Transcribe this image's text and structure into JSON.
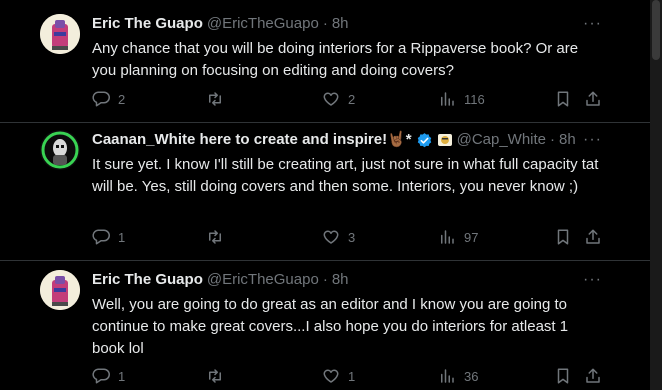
{
  "tweets": [
    {
      "display_name": "Eric The Guapo",
      "handle": "@EricTheGuapo",
      "separator": "·",
      "time": "8h",
      "more": "···",
      "text": "Any chance that you will be doing interiors for a Rippaverse book? Or are you planning on focusing on editing and doing covers?",
      "replies": "2",
      "retweets": "",
      "likes": "2",
      "views": "116"
    },
    {
      "display_name": "Caanan_White here to create and inspire!",
      "name_emoji": "🤘🏾*",
      "verified": true,
      "handle": "@Cap_White",
      "separator": "·",
      "time": "8h",
      "more": "···",
      "text": "It sure yet.  I know I'll still be creating art, just not sure in what full capacity tat will be.  Yes, still doing covers and then some.  Interiors, you never know ;)",
      "replies": "1",
      "retweets": "",
      "likes": "3",
      "views": "97"
    },
    {
      "display_name": "Eric The Guapo",
      "handle": "@EricTheGuapo",
      "separator": "·",
      "time": "8h",
      "more": "···",
      "text": "Well, you are going to do great as an editor and I know you are going to continue to make great covers...I also hope you do interiors for atleast 1 book lol",
      "replies": "1",
      "retweets": "",
      "likes": "1",
      "views": "36"
    }
  ],
  "colors": {
    "background": "#000000",
    "text": "#e7e9ea",
    "muted": "#71767b",
    "verified": "#1d9bf0",
    "divider": "#2f3336"
  },
  "icons": [
    "reply-icon",
    "retweet-icon",
    "like-icon",
    "views-icon",
    "bookmark-icon",
    "share-icon",
    "verified-badge-icon",
    "affiliate-badge-icon"
  ]
}
